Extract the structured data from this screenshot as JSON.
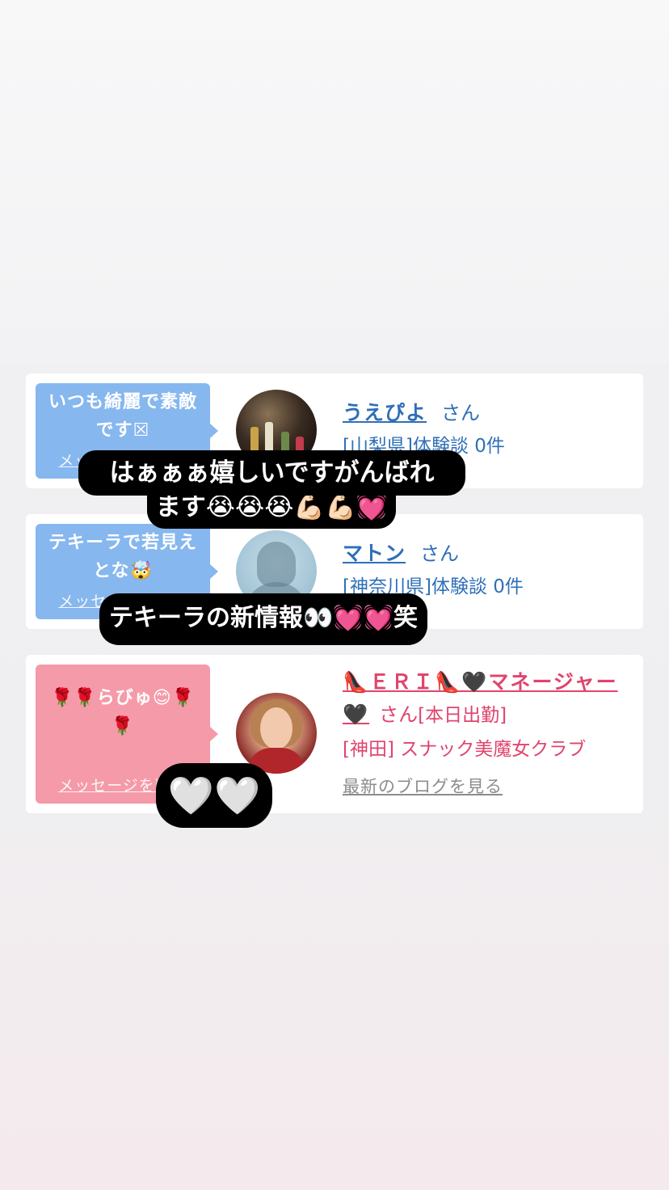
{
  "cards": [
    {
      "bubble_text": "いつも綺麗で素敵です☒",
      "delete_label": "メッセージを削除",
      "name": "うえぴよ",
      "honorific": "さん",
      "meta": "[山梨県]体験談 0件"
    },
    {
      "bubble_text": "テキーラで若見えとな🤯",
      "delete_label": "メッセージを削除",
      "name": "マトン",
      "honorific": "さん",
      "meta": "[神奈川県]体験談 0件"
    },
    {
      "bubble_text": "🌹🌹らびゅ😊🌹🌹",
      "delete_label": "メッセージを削除",
      "name": "👠ＥＲＩ👠🖤マネージャー🖤",
      "honorific": "さん",
      "status": "[本日出勤]",
      "meta": "[神田] スナック美魔女クラブ",
      "blog_link": "最新のブログを見る"
    }
  ],
  "overlays": {
    "reply1_line1": "はぁぁぁ嬉しいですがんばれ",
    "reply1_line2": "ます😭😭😭💪🏻💪🏻💓",
    "reply2": "テキーラの新情報👀💓💓笑",
    "reply3": "🤍🤍"
  },
  "colors": {
    "blue_bubble": "#86b7ee",
    "pink_bubble": "#f59aa8",
    "link_blue": "#2f6fb8",
    "link_pink": "#e0446d"
  }
}
